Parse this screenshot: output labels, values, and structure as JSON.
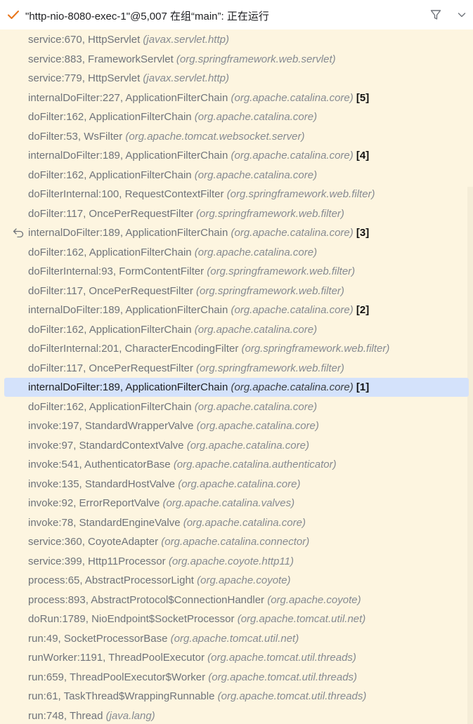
{
  "header": {
    "title": "\"http-nio-8080-exec-1\"@5,007 在组“main”: 正在运行",
    "status_icon": "check-icon",
    "filter_icon": "filter-icon",
    "chevron_icon": "chevron-down-icon",
    "accent_color": "#3574f0",
    "check_color": "#e8751a"
  },
  "frames": [
    {
      "method": "service:670, HttpServlet",
      "package": "(javax.servlet.http)",
      "num": ""
    },
    {
      "method": "service:883, FrameworkServlet",
      "package": "(org.springframework.web.servlet)",
      "num": ""
    },
    {
      "method": "service:779, HttpServlet",
      "package": "(javax.servlet.http)",
      "num": ""
    },
    {
      "method": "internalDoFilter:227, ApplicationFilterChain",
      "package": "(org.apache.catalina.core)",
      "num": "[5]"
    },
    {
      "method": "doFilter:162, ApplicationFilterChain",
      "package": "(org.apache.catalina.core)",
      "num": ""
    },
    {
      "method": "doFilter:53, WsFilter",
      "package": "(org.apache.tomcat.websocket.server)",
      "num": ""
    },
    {
      "method": "internalDoFilter:189, ApplicationFilterChain",
      "package": "(org.apache.catalina.core)",
      "num": "[4]"
    },
    {
      "method": "doFilter:162, ApplicationFilterChain",
      "package": "(org.apache.catalina.core)",
      "num": ""
    },
    {
      "method": "doFilterInternal:100, RequestContextFilter",
      "package": "(org.springframework.web.filter)",
      "num": ""
    },
    {
      "method": "doFilter:117, OncePerRequestFilter",
      "package": "(org.springframework.web.filter)",
      "num": ""
    },
    {
      "method": "internalDoFilter:189, ApplicationFilterChain",
      "package": "(org.apache.catalina.core)",
      "num": "[3]",
      "icon": "return-icon"
    },
    {
      "method": "doFilter:162, ApplicationFilterChain",
      "package": "(org.apache.catalina.core)",
      "num": ""
    },
    {
      "method": "doFilterInternal:93, FormContentFilter",
      "package": "(org.springframework.web.filter)",
      "num": ""
    },
    {
      "method": "doFilter:117, OncePerRequestFilter",
      "package": "(org.springframework.web.filter)",
      "num": ""
    },
    {
      "method": "internalDoFilter:189, ApplicationFilterChain",
      "package": "(org.apache.catalina.core)",
      "num": "[2]"
    },
    {
      "method": "doFilter:162, ApplicationFilterChain",
      "package": "(org.apache.catalina.core)",
      "num": ""
    },
    {
      "method": "doFilterInternal:201, CharacterEncodingFilter",
      "package": "(org.springframework.web.filter)",
      "num": ""
    },
    {
      "method": "doFilter:117, OncePerRequestFilter",
      "package": "(org.springframework.web.filter)",
      "num": ""
    },
    {
      "method": "internalDoFilter:189, ApplicationFilterChain",
      "package": "(org.apache.catalina.core)",
      "num": "[1]",
      "selected": true
    },
    {
      "method": "doFilter:162, ApplicationFilterChain",
      "package": "(org.apache.catalina.core)",
      "num": ""
    },
    {
      "method": "invoke:197, StandardWrapperValve",
      "package": "(org.apache.catalina.core)",
      "num": ""
    },
    {
      "method": "invoke:97, StandardContextValve",
      "package": "(org.apache.catalina.core)",
      "num": ""
    },
    {
      "method": "invoke:541, AuthenticatorBase",
      "package": "(org.apache.catalina.authenticator)",
      "num": ""
    },
    {
      "method": "invoke:135, StandardHostValve",
      "package": "(org.apache.catalina.core)",
      "num": ""
    },
    {
      "method": "invoke:92, ErrorReportValve",
      "package": "(org.apache.catalina.valves)",
      "num": ""
    },
    {
      "method": "invoke:78, StandardEngineValve",
      "package": "(org.apache.catalina.core)",
      "num": ""
    },
    {
      "method": "service:360, CoyoteAdapter",
      "package": "(org.apache.catalina.connector)",
      "num": ""
    },
    {
      "method": "service:399, Http11Processor",
      "package": "(org.apache.coyote.http11)",
      "num": ""
    },
    {
      "method": "process:65, AbstractProcessorLight",
      "package": "(org.apache.coyote)",
      "num": ""
    },
    {
      "method": "process:893, AbstractProtocol$ConnectionHandler",
      "package": "(org.apache.coyote)",
      "num": ""
    },
    {
      "method": "doRun:1789, NioEndpoint$SocketProcessor",
      "package": "(org.apache.tomcat.util.net)",
      "num": ""
    },
    {
      "method": "run:49, SocketProcessorBase",
      "package": "(org.apache.tomcat.util.net)",
      "num": ""
    },
    {
      "method": "runWorker:1191, ThreadPoolExecutor",
      "package": "(org.apache.tomcat.util.threads)",
      "num": ""
    },
    {
      "method": "run:659, ThreadPoolExecutor$Worker",
      "package": "(org.apache.tomcat.util.threads)",
      "num": ""
    },
    {
      "method": "run:61, TaskThread$WrappingRunnable",
      "package": "(org.apache.tomcat.util.threads)",
      "num": ""
    },
    {
      "method": "run:748, Thread",
      "package": "(java.lang)",
      "num": ""
    }
  ]
}
